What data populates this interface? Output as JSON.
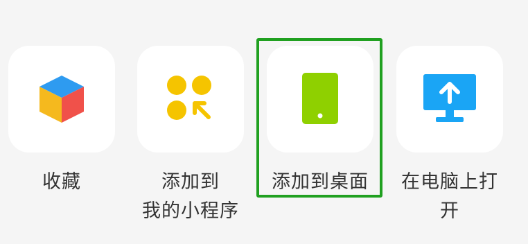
{
  "share_actions": {
    "items": [
      {
        "label": "收藏",
        "icon": "cube-icon"
      },
      {
        "label": "添加到\n我的小程序",
        "icon": "miniprogram-grid-icon"
      },
      {
        "label": "添加到桌面",
        "icon": "phone-icon",
        "highlighted": true
      },
      {
        "label": "在电脑上打\n开",
        "icon": "desktop-upload-icon"
      }
    ]
  },
  "colors": {
    "background": "#f5f5f5",
    "tile": "#ffffff",
    "highlight_border": "#20a020",
    "cube_top": "#2e9bf0",
    "cube_left": "#f5b91e",
    "cube_right": "#f0514a",
    "dots": "#f5c400",
    "phone": "#8fd000",
    "monitor": "#1aa5f5"
  }
}
